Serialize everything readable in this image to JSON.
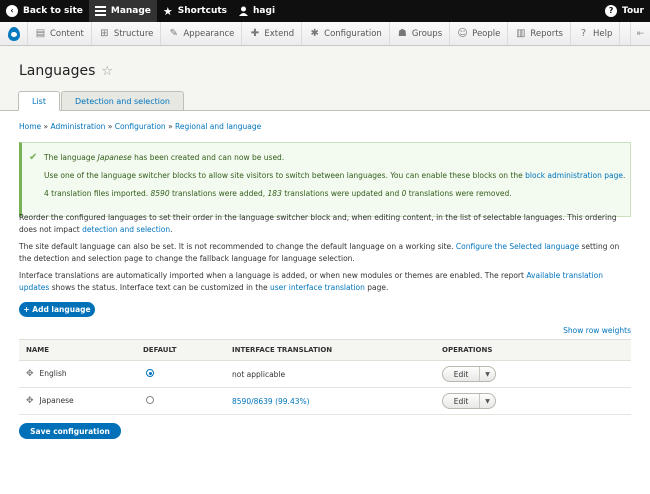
{
  "toolbar": {
    "back_label": "Back to site",
    "manage_label": "Manage",
    "shortcuts_label": "Shortcuts",
    "user_label": "hagi",
    "tour_label": "Tour"
  },
  "tray": {
    "items": [
      {
        "label": "Content",
        "icon": "content-icon"
      },
      {
        "label": "Structure",
        "icon": "structure-icon"
      },
      {
        "label": "Appearance",
        "icon": "appearance-icon"
      },
      {
        "label": "Extend",
        "icon": "extend-icon"
      },
      {
        "label": "Configuration",
        "icon": "configuration-icon"
      },
      {
        "label": "Groups",
        "icon": "groups-icon"
      },
      {
        "label": "People",
        "icon": "people-icon"
      },
      {
        "label": "Reports",
        "icon": "reports-icon"
      },
      {
        "label": "Help",
        "icon": "help-icon"
      }
    ]
  },
  "page": {
    "title": "Languages",
    "tabs": [
      "List",
      "Detection and selection"
    ]
  },
  "breadcrumb": {
    "home": "Home",
    "sep": "»",
    "administration": "Administration",
    "configuration": "Configuration",
    "regional": "Regional and language"
  },
  "messages": {
    "line1_a": "The language ",
    "line1_lang": "Japanese",
    "line1_b": " has been created and can now be used.",
    "line2_a": "Use one of the language switcher blocks to allow site visitors to switch between languages. You can enable these blocks on the ",
    "line2_link": "block administration page",
    "line2_b": ".",
    "line3_a": "4 translation files imported. ",
    "line3_added": "8590",
    "line3_b": " translations were added, ",
    "line3_updated": "183",
    "line3_c": " translations were updated and ",
    "line3_removed": "0",
    "line3_d": " translations were removed."
  },
  "description": {
    "p1_a": "Reorder the configured languages to set their order in the language switcher block and, when editing content, in the list of selectable languages. This ordering does not impact ",
    "p1_link": "detection and selection",
    "p1_b": ".",
    "p2_a": "The site default language can also be set. It is not recommended to change the default language on a working site. ",
    "p2_link": "Configure the Selected language",
    "p2_b": " setting on the detection and selection page to change the fallback language for language selection.",
    "p3_a": "Interface translations are automatically imported when a language is added, or when new modules or themes are enabled. The report ",
    "p3_link1": "Available translation updates",
    "p3_b": " shows the status. Interface text can be customized in the ",
    "p3_link2": "user interface translation",
    "p3_c": " page."
  },
  "add_language_label": "+ Add language",
  "row_weights_label": "Show row weights",
  "table": {
    "headers": [
      "NAME",
      "DEFAULT",
      "INTERFACE TRANSLATION",
      "OPERATIONS"
    ],
    "rows": [
      {
        "name": "English",
        "default": true,
        "translation": "not applicable",
        "translation_is_link": false,
        "operation": "Edit"
      },
      {
        "name": "Japanese",
        "default": false,
        "translation": "8590/8639 (99.43%)",
        "translation_is_link": true,
        "operation": "Edit"
      }
    ]
  },
  "save_label": "Save configuration",
  "colors": {
    "primary": "#0071b8",
    "link": "#0074bd",
    "status_green": "#77b259"
  }
}
